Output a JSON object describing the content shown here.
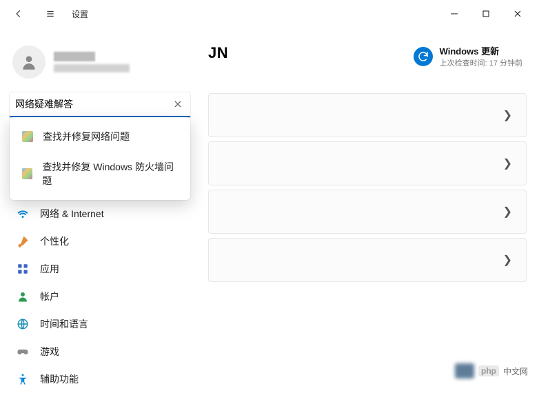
{
  "titlebar": {
    "title": "设置"
  },
  "user": {
    "name_redacted": true
  },
  "search": {
    "value": "网络疑难解答",
    "suggestions": [
      {
        "label": "查找并修复网络问题"
      },
      {
        "label": "查找并修复 Windows 防火墙问题"
      }
    ]
  },
  "sidebar_items": [
    {
      "label": "网络 & Internet",
      "icon": "wifi",
      "color": "#0b88da"
    },
    {
      "label": "个性化",
      "icon": "brush",
      "color": "#e48b3a"
    },
    {
      "label": "应用",
      "icon": "apps",
      "color": "#3b62c4"
    },
    {
      "label": "帐户",
      "icon": "person",
      "color": "#2b9a52"
    },
    {
      "label": "时间和语言",
      "icon": "globe",
      "color": "#1b8fb3"
    },
    {
      "label": "游戏",
      "icon": "gamepad",
      "color": "#8a8a8a"
    },
    {
      "label": "辅助功能",
      "icon": "access",
      "color": "#0b88da"
    }
  ],
  "main": {
    "heading_suffix": "JN",
    "update": {
      "title": "Windows 更新",
      "subtitle": "上次检查时间: 17 分钟前"
    }
  },
  "watermark": {
    "tag": "php",
    "text": "中文网"
  }
}
